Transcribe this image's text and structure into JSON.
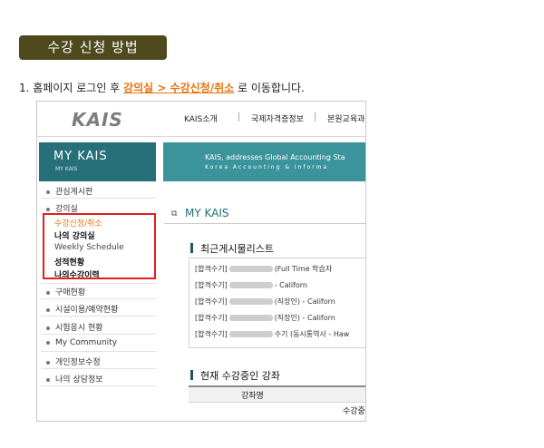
{
  "title": "수강 신청 방법",
  "step": {
    "prefix": "1. 홈페이지 로그인 후 ",
    "link": "강의실 > 수강신청/취소",
    "suffix": " 로 이동합니다."
  },
  "screenshot": {
    "logo": "KAIS",
    "nav": [
      "KAIS소개",
      "국제자격증정보",
      "본원교육과"
    ],
    "side_title": "MY  KAIS",
    "side_subtitle": "MY KAIS",
    "banner_line1": "KAIS, addresses Global Accounting Sta",
    "banner_line2": "Korea Accounting & Informa",
    "menu": [
      {
        "label": "관심게시판"
      },
      {
        "label": "강의실"
      },
      {
        "label": "구매현황"
      },
      {
        "label": "시설이용/예약현황"
      },
      {
        "label": "시험응시 현황"
      },
      {
        "label": "My Community"
      },
      {
        "label": "개인정보수정"
      },
      {
        "label": "나의 상담정보"
      }
    ],
    "submenu": [
      {
        "label": "수강신청/취소",
        "color": "#e8720c"
      },
      {
        "label": "나의 강의실",
        "color": "#111111"
      },
      {
        "label": "Weekly Schedule",
        "color": "#444444"
      },
      {
        "label": "성적현황",
        "color": "#111111"
      },
      {
        "label": "나의수강이력",
        "color": "#111111"
      }
    ],
    "page_title": "MY KAIS",
    "recent_title": "최근게시물리스트",
    "posts": [
      {
        "prefix": "[합격수기]",
        "suffix": "(Full Time 학습자"
      },
      {
        "prefix": "[합격수기]",
        "suffix": "- Californ"
      },
      {
        "prefix": "[합격수기]",
        "suffix": "(직장인) - Californ"
      },
      {
        "prefix": "[합격수기]",
        "suffix": "(직장인) - Californ"
      },
      {
        "prefix": "[합격수기]",
        "suffix": "수기 (동시통역사 - Haw"
      }
    ],
    "current_title": "현재 수강중인 강좌",
    "table_header": "강좌명",
    "table_cell": "수강중"
  },
  "colors": {
    "title_bg": "#4e4a1d",
    "link": "#e8720c",
    "highlight_box": "#e02020",
    "teal": "#27707a"
  }
}
